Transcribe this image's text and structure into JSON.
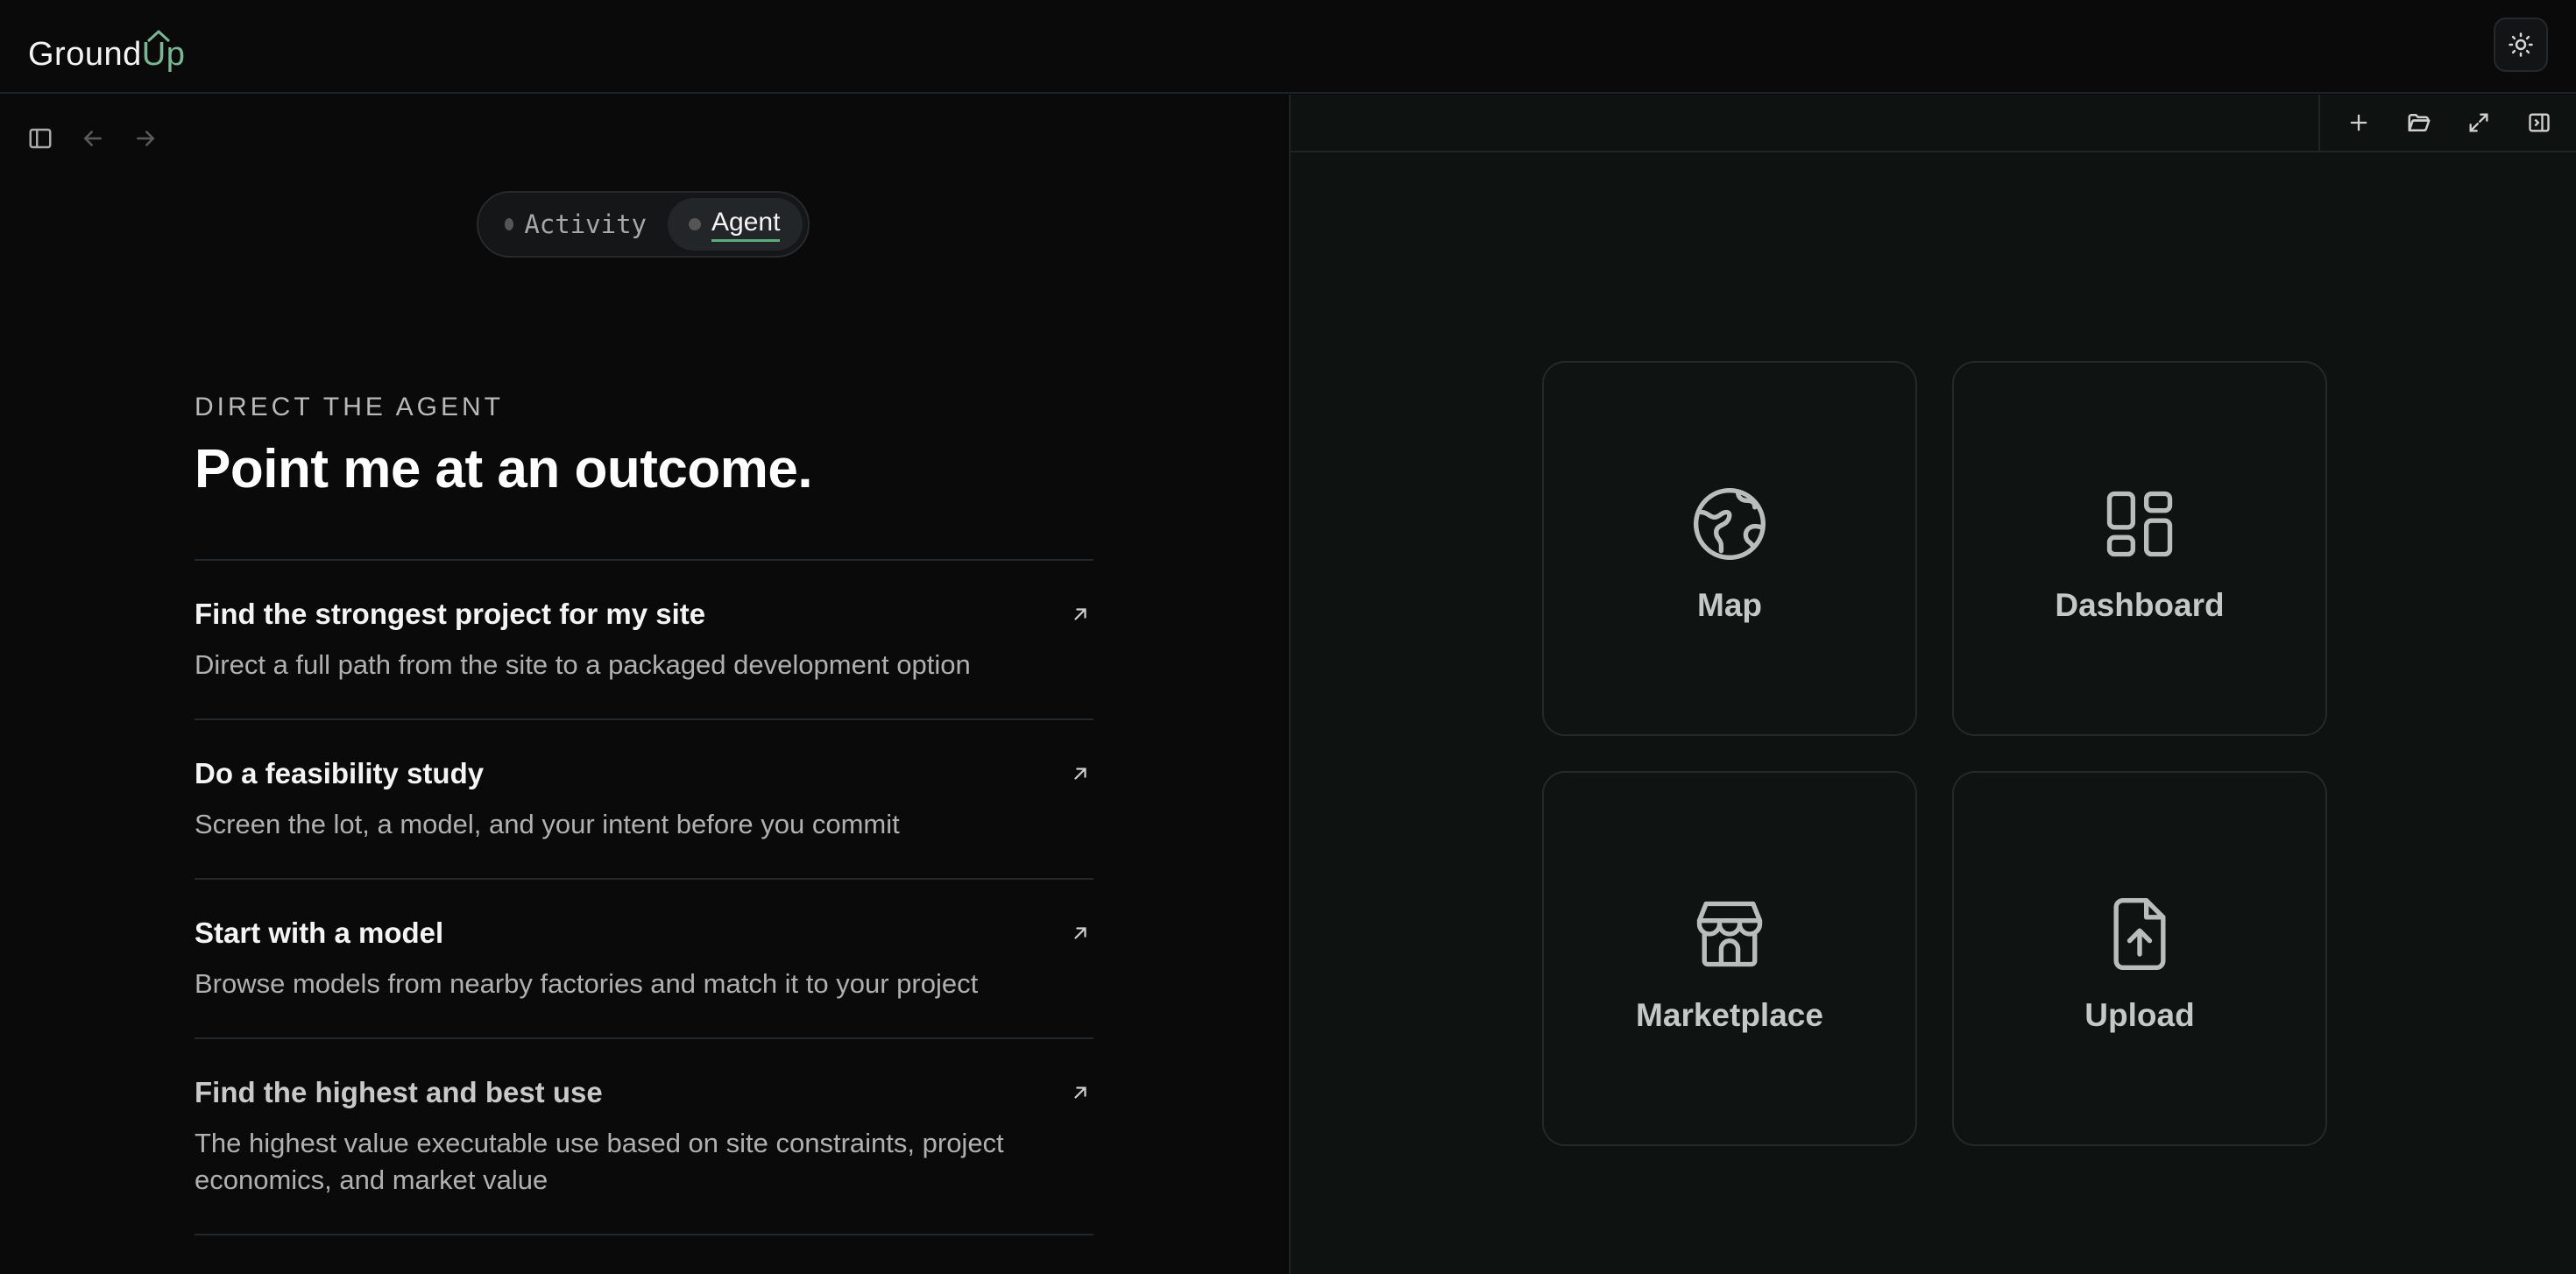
{
  "app": {
    "logo_left": "Ground",
    "logo_right": "Up"
  },
  "toggle": {
    "activity": "Activity",
    "agent": "Agent"
  },
  "hero": {
    "eyebrow": "DIRECT THE AGENT",
    "headline": "Point me at an outcome."
  },
  "options": [
    {
      "title": "Find the strongest project for my site",
      "desc": "Direct a full path from the site to a packaged development option"
    },
    {
      "title": "Do a feasibility study",
      "desc": "Screen the lot, a model, and your intent before you commit"
    },
    {
      "title": "Start with a model",
      "desc": "Browse models from nearby factories and match it to your project"
    },
    {
      "title": "Find the highest and best use",
      "desc": "The highest value executable use based on site constraints, project economics, and market value"
    }
  ],
  "cards": [
    {
      "label": "Map",
      "icon": "globe-icon"
    },
    {
      "label": "Dashboard",
      "icon": "dashboard-icon"
    },
    {
      "label": "Marketplace",
      "icon": "store-icon"
    },
    {
      "label": "Upload",
      "icon": "file-upload-icon"
    }
  ],
  "colors": {
    "accent": "#5cae80",
    "background": "#0a0a0b",
    "panel": "#0e1312"
  }
}
